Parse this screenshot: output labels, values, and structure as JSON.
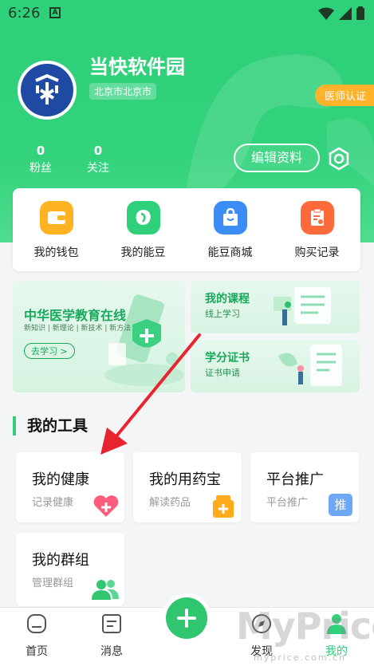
{
  "status_bar": {
    "time": "6:26",
    "a_icon": "A"
  },
  "profile": {
    "name": "当快软件园",
    "location": "北京市北京市",
    "doctor_badge": "医师认证",
    "fans_count": "0",
    "fans_label": "粉丝",
    "follow_count": "0",
    "follow_label": "关注",
    "edit_label": "编辑资料"
  },
  "actions": [
    {
      "label": "我的钱包",
      "icon": "wallet-icon",
      "color": "#ffb322"
    },
    {
      "label": "我的能豆",
      "icon": "bean-icon",
      "color": "#2fd07a"
    },
    {
      "label": "能豆商城",
      "icon": "shop-bag-icon",
      "color": "#3b8df5"
    },
    {
      "label": "购买记录",
      "icon": "clipboard-icon",
      "color": "#ff6a3d"
    }
  ],
  "banners": {
    "main_title": "中华医学教育在线",
    "main_subtitle": "新知识 | 新理论 | 新技术 | 新方法",
    "main_button": "去学习 >",
    "course_title": "我的课程",
    "course_subtitle": "线上学习",
    "cert_title": "学分证书",
    "cert_subtitle": "证书申请"
  },
  "tools": {
    "section_title": "我的工具",
    "items": [
      {
        "title": "我的健康",
        "subtitle": "记录健康",
        "icon": "heart-plus-icon"
      },
      {
        "title": "我的用药宝",
        "subtitle": "解读药品",
        "icon": "medicine-icon"
      },
      {
        "title": "平台推广",
        "subtitle": "平台推广",
        "icon_text": "推"
      },
      {
        "title": "我的群组",
        "subtitle": "管理群组",
        "icon": "group-icon"
      }
    ]
  },
  "nav": {
    "items": [
      {
        "label": "首页",
        "icon": "home-icon"
      },
      {
        "label": "消息",
        "icon": "message-icon"
      },
      {
        "label": "发现",
        "icon": "compass-icon"
      },
      {
        "label": "我的",
        "icon": "profile-icon"
      }
    ],
    "add_icon": "plus-icon"
  },
  "watermark": {
    "brand": "MyPrice",
    "url": "myprice.com.cn"
  },
  "colors": {
    "primary": "#2fd07a",
    "accent": "#ffb22b",
    "arrow": "#e8252f"
  }
}
